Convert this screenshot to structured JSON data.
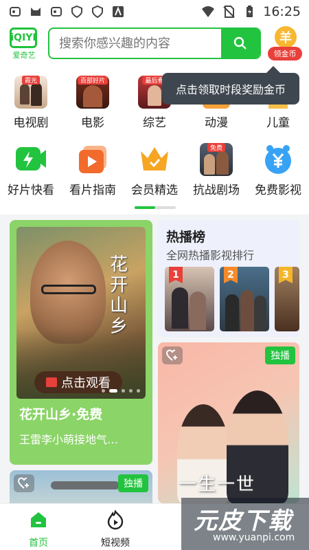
{
  "status_bar": {
    "time": "16:25",
    "left_icons": [
      "app-notification-icon",
      "cat-icon",
      "app-notification-icon",
      "shield-icon",
      "shield-icon",
      "text-a-icon"
    ],
    "right_icons": [
      "wifi-icon",
      "no-sim-icon",
      "battery-charging-icon"
    ]
  },
  "header": {
    "logo_mark": "iQIYI",
    "logo_text": "爱奇艺",
    "search_placeholder": "搜索你感兴趣的内容",
    "coin_symbol": "羊",
    "coin_label": "领金币"
  },
  "tooltip": "点击领取时段奖励金币",
  "categories_row1": [
    {
      "label": "电视剧",
      "tag": "霞光"
    },
    {
      "label": "电影",
      "tag": "百部好片"
    },
    {
      "label": "综艺",
      "tag": "最后看"
    },
    {
      "label": "动漫",
      "tag": ""
    },
    {
      "label": "儿童",
      "tag": ""
    }
  ],
  "categories_row2": [
    {
      "label": "好片快看",
      "icon": "lightning-icon"
    },
    {
      "label": "看片指南",
      "icon": "play-icon"
    },
    {
      "label": "会员精选",
      "icon": "crown-icon"
    },
    {
      "label": "抗战剧场",
      "icon": "poster-thumb",
      "tag": "免费"
    },
    {
      "label": "免费影视",
      "icon": "yuan-clock-icon"
    }
  ],
  "feed": {
    "main_card": {
      "poster_title": "花开山乡",
      "watch_label": "点击观看",
      "title": "花开山乡·免费",
      "subtitle": "王雷李小萌接地气…",
      "color": "#8bd468"
    },
    "hot_list": {
      "title": "热播榜",
      "subtitle": "全网热播影视排行",
      "ranks": [
        "1",
        "2",
        "3"
      ],
      "rank_colors": [
        "#e8403a",
        "#f58a2a",
        "#f5b52a"
      ]
    },
    "card_2": {
      "badge": "独播",
      "title": "一生一世"
    },
    "card_3": {
      "badge": "独播"
    }
  },
  "bottom_nav": [
    {
      "label": "首页",
      "icon": "home-icon",
      "active": true
    },
    {
      "label": "短视频",
      "icon": "flame-play-icon",
      "active": false
    }
  ],
  "watermark": {
    "logo": "元皮下载",
    "url": "www.yuanpi.com"
  },
  "accent_color": "#22c33f"
}
